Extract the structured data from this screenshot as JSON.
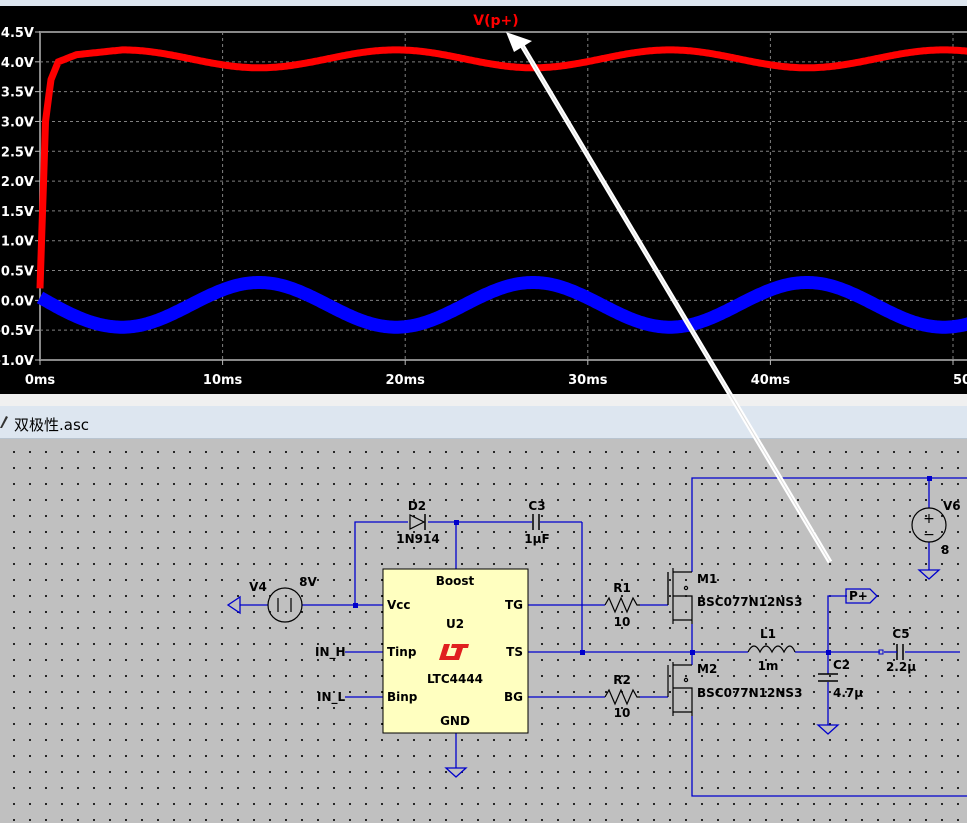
{
  "window": {
    "schematic_title": "双极性.asc"
  },
  "waveform": {
    "trace_label": "V(p+)",
    "trace_color": "#ff0000",
    "second_trace_color": "#0000ff",
    "background": "#000000",
    "y_ticks": [
      "4.5V",
      "4.0V",
      "3.5V",
      "3.0V",
      "2.5V",
      "2.0V",
      "1.5V",
      "1.0V",
      "0.5V",
      "0.0V",
      "-0.5V",
      "-1.0V"
    ],
    "x_ticks": [
      "0ms",
      "10ms",
      "20ms",
      "30ms",
      "40ms",
      "50ms"
    ]
  },
  "chart_data": {
    "type": "line",
    "xlim": [
      0,
      51
    ],
    "ylim": [
      -1.0,
      4.5
    ],
    "grid": true,
    "series": [
      {
        "name": "V(p+)",
        "x": [
          0,
          0.3,
          0.6,
          1,
          2,
          4.5,
          12,
          19.5,
          27,
          34.5,
          42,
          49.5
        ],
        "y": [
          0.2,
          3.0,
          3.7,
          4.0,
          4.12,
          4.2,
          3.9,
          4.2,
          3.9,
          4.2,
          3.9,
          4.2
        ]
      },
      {
        "x": [
          0,
          4.5,
          12,
          19.5,
          27,
          34.5,
          42,
          49.5
        ],
        "y": [
          0.05,
          -0.45,
          0.3,
          -0.45,
          0.3,
          -0.45,
          0.3,
          -0.45
        ]
      }
    ]
  },
  "schematic": {
    "components": {
      "u2_name": "U2",
      "u2_part": "LTC4444",
      "pin_boost": "Boost",
      "pin_vcc": "Vcc",
      "pin_tinp": "Tinp",
      "pin_binp": "Binp",
      "pin_gnd": "GND",
      "pin_tg": "TG",
      "pin_ts": "TS",
      "pin_bg": "BG",
      "d2_name": "D2",
      "d2_value": "1N914",
      "c3_name": "C3",
      "c3_value": "1µF",
      "v4_name": "V4",
      "v4_value": "8V",
      "r1_name": "R1",
      "r1_value": "10",
      "r2_name": "R2",
      "r2_value": "10",
      "m1_name": "M1",
      "m1_part": "BSC077N12NS3",
      "m2_name": "M2",
      "m2_part": "BSC077N12NS3",
      "l1_name": "L1",
      "l1_value": "1m",
      "c2_name": "C2",
      "c2_value": "4.7µ",
      "c5_name": "C5",
      "c5_value": "2.2µ",
      "v6_name": "V6",
      "v6_value": "8",
      "net_p": "P+",
      "net_in_h": "IN_H",
      "net_in_l": "IN_L"
    },
    "colors": {
      "wire": "#0000cc",
      "component_fill": "#ffffc0",
      "logo_red": "#e02020"
    }
  }
}
